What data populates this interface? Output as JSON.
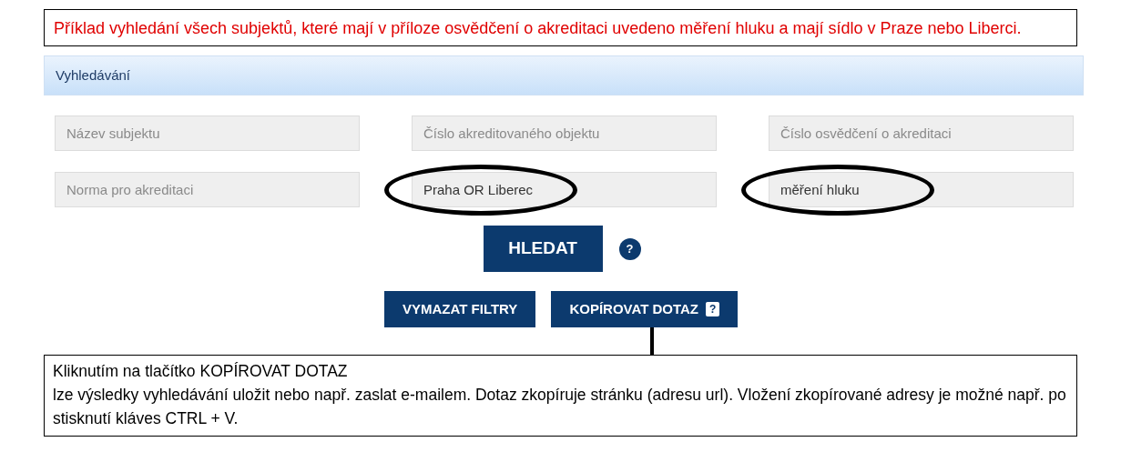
{
  "note_top": {
    "text": "Příklad vyhledání všech subjektů, které mají v příloze osvědčení o akreditaci uvedeno měření hluku a mají sídlo v Praze nebo Liberci."
  },
  "panel": {
    "title": "Vyhledávání",
    "fields": [
      {
        "placeholder": "Název subjektu",
        "highlighted": false
      },
      {
        "placeholder": "Číslo akreditovaného objektu",
        "highlighted": false
      },
      {
        "placeholder": "Číslo osvědčení o akreditaci",
        "highlighted": false
      },
      {
        "placeholder": "Norma pro akreditaci",
        "highlighted": false
      },
      {
        "value": "Praha OR Liberec",
        "highlighted": true
      },
      {
        "value": "měření hluku",
        "highlighted": true
      }
    ],
    "search_button": "HLEDAT",
    "search_help": "?",
    "buttons": [
      {
        "label": "VYMAZAT FILTRY"
      },
      {
        "label": "KOPÍROVAT DOTAZ",
        "help": "?"
      }
    ]
  },
  "note_bottom": {
    "lines": [
      "Kliknutím na tlačítko KOPÍROVAT DOTAZ",
      "lze výsledky vyhledávání uložit nebo např. zaslat e-mailem. Dotaz zkopíruje stránku (adresu url). Vložení zkopírované adresy je možné např. po stisknutí kláves CTRL + V."
    ]
  }
}
